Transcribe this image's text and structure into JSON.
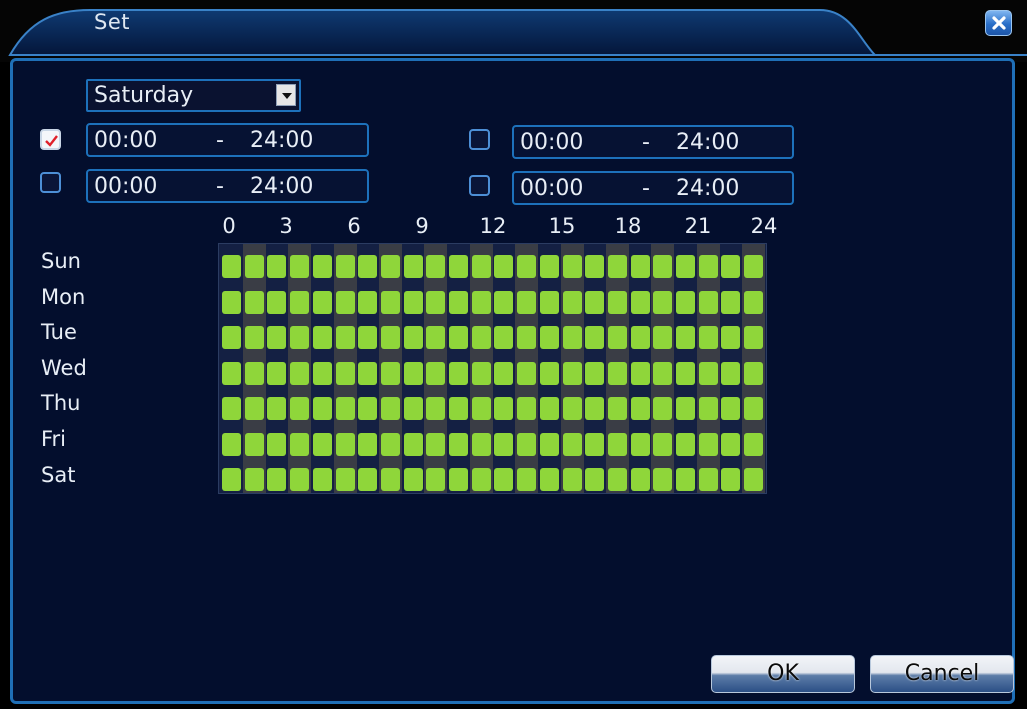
{
  "window": {
    "title": "Set"
  },
  "day_select": {
    "value": "Saturday"
  },
  "periods": [
    {
      "checked": true,
      "start": "00:00",
      "sep": "-",
      "end": "24:00"
    },
    {
      "checked": false,
      "start": "00:00",
      "sep": "-",
      "end": "24:00"
    },
    {
      "checked": false,
      "start": "00:00",
      "sep": "-",
      "end": "24:00"
    },
    {
      "checked": false,
      "start": "00:00",
      "sep": "-",
      "end": "24:00"
    }
  ],
  "schedule": {
    "hour_labels": [
      "0",
      "3",
      "6",
      "9",
      "12",
      "15",
      "18",
      "21",
      "24"
    ],
    "days": [
      "Sun",
      "Mon",
      "Tue",
      "Wed",
      "Thu",
      "Fri",
      "Sat"
    ],
    "slots_per_day": 24,
    "active_color": "#8fd63a"
  },
  "buttons": {
    "ok": "OK",
    "cancel": "Cancel"
  },
  "colors": {
    "panel_bg": "#030e2d",
    "border": "#1f6fb6",
    "accent": "#2a6fc8"
  },
  "icons": {
    "close": "close-icon",
    "dropdown": "chevron-down-icon",
    "check": "checkmark-icon"
  }
}
